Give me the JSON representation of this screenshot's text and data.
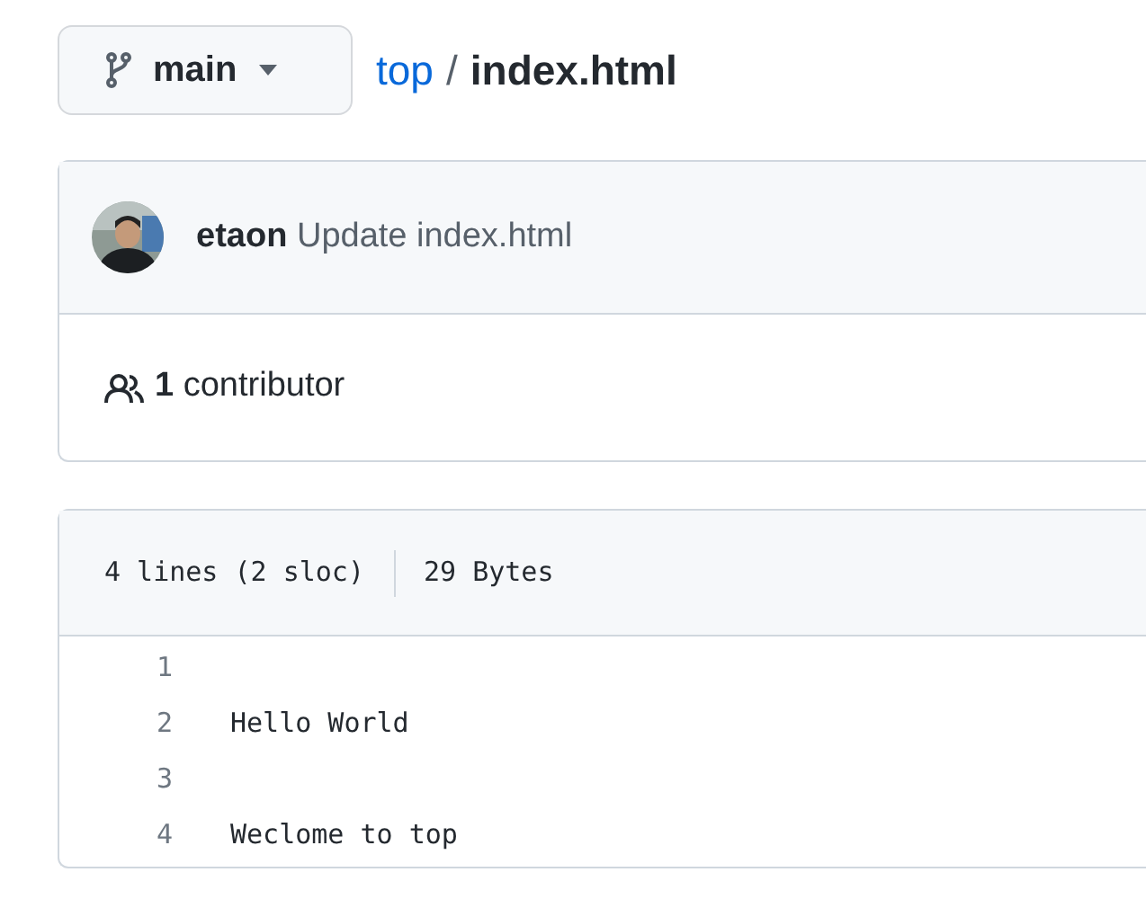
{
  "branch_button": {
    "label": "main"
  },
  "breadcrumb": {
    "repo_link": "top",
    "separator": "/",
    "file": "index.html"
  },
  "commit": {
    "author": "etaon",
    "message": "Update index.html"
  },
  "contributors": {
    "count": "1",
    "label": "contributor"
  },
  "file_info": {
    "lines": "4 lines (2 sloc)",
    "size": "29 Bytes"
  },
  "code_lines": [
    {
      "number": "1"
    },
    {
      "number": "2",
      "text": "Hello World"
    },
    {
      "number": "3"
    },
    {
      "number": "4",
      "text": "Weclome to top"
    }
  ]
}
